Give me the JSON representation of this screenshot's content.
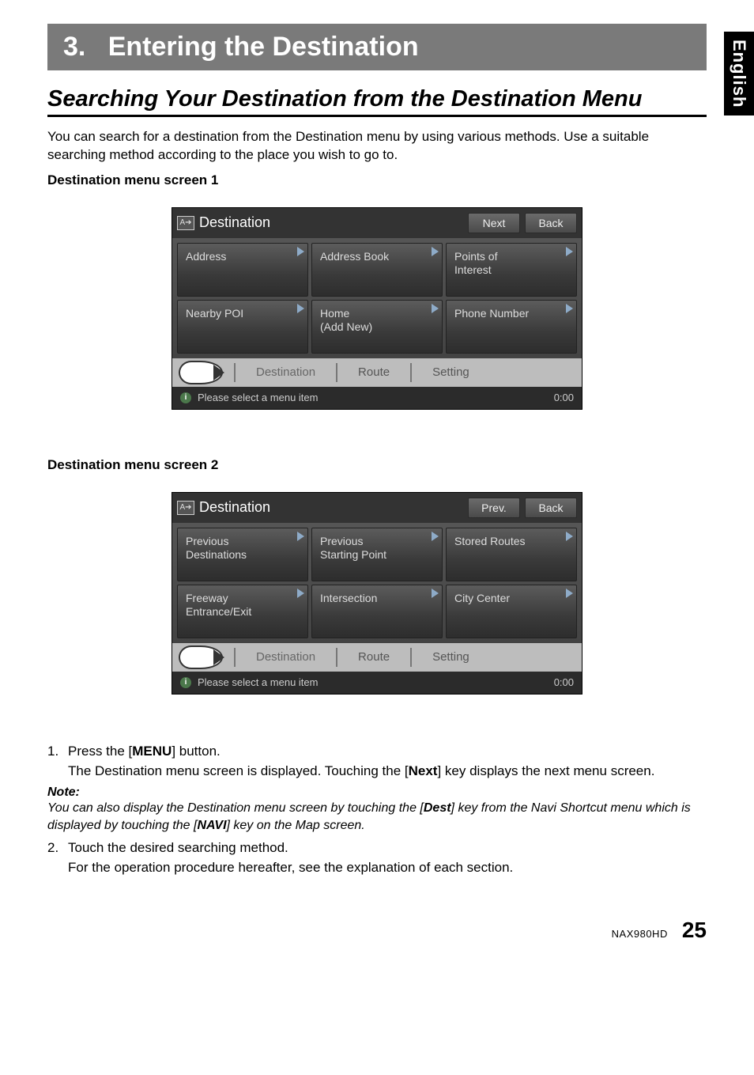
{
  "language_tab": "English",
  "chapter": {
    "number": "3.",
    "title": "Entering the Destination"
  },
  "section_title": "Searching Your Destination from the Destination Menu",
  "intro": "You can search for a destination from the Destination menu by using various methods. Use a suitable searching method according to the place you wish to go to.",
  "screen1_label": "Destination menu screen 1",
  "screen2_label": "Destination menu screen 2",
  "screen1": {
    "title": "Destination",
    "nav_left": "Next",
    "nav_right": "Back",
    "buttons": [
      "Address",
      "Address Book",
      "Points of\nInterest",
      "Nearby POI",
      "Home\n(Add New)",
      "Phone Number"
    ],
    "tabs": {
      "a": "Destination",
      "b": "Route",
      "c": "Setting"
    },
    "status": "Please select a menu item",
    "time": "0:00"
  },
  "screen2": {
    "title": "Destination",
    "nav_left": "Prev.",
    "nav_right": "Back",
    "buttons": [
      "Previous\nDestinations",
      "Previous\nStarting Point",
      "Stored Routes",
      "Freeway\nEntrance/Exit",
      "Intersection",
      "City Center"
    ],
    "tabs": {
      "a": "Destination",
      "b": "Route",
      "c": "Setting"
    },
    "status": "Please select a menu item",
    "time": "0:00"
  },
  "instructions": {
    "step1_num": "1.",
    "step1_a": "Press the [",
    "step1_bold": "MENU",
    "step1_b": "] button.",
    "step1_line2a": "The Destination menu screen is displayed. Touching the [",
    "step1_line2bold": "Next",
    "step1_line2b": "] key displays the next menu screen.",
    "step2_num": "2.",
    "step2_a": "Touch the desired searching method.",
    "step2_b": "For the operation procedure hereafter, see the explanation of each section."
  },
  "note": {
    "head": "Note:",
    "p1a": "You can also display the Destination menu screen by touching the [",
    "p1bold1": "Dest",
    "p1b": "] key from the Navi Shortcut menu which is displayed by touching the [",
    "p1bold2": "NAVI",
    "p1c": "] key on the Map screen."
  },
  "footer": {
    "model": "NAX980HD",
    "page": "25"
  }
}
